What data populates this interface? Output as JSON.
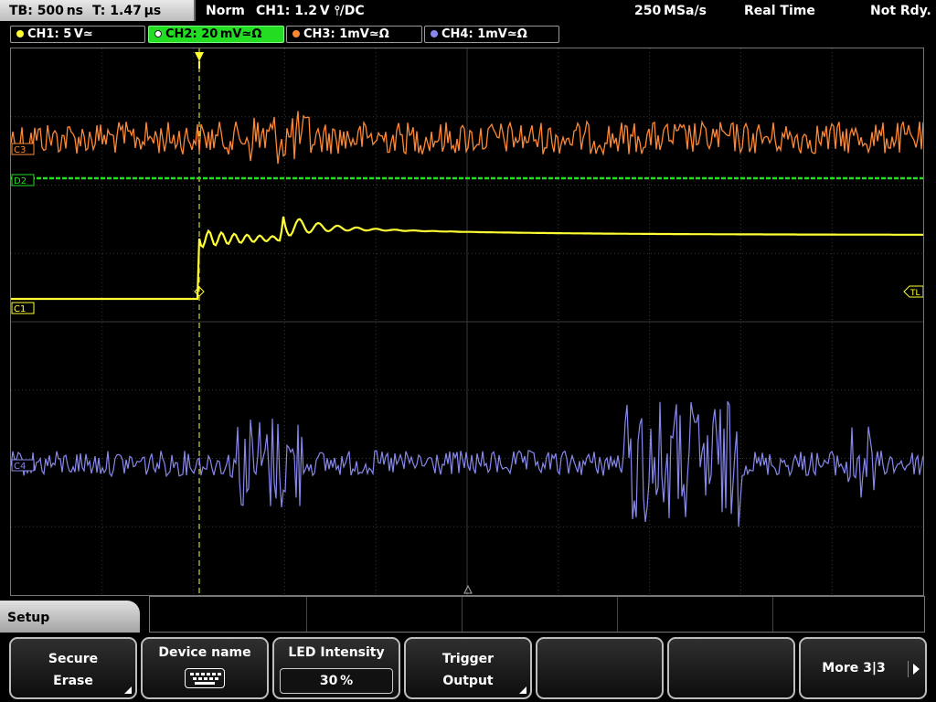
{
  "status_bar": {
    "tb": "TB: 500 ns",
    "t": "T: 1.47 µs",
    "mode": "Norm",
    "trigger": "CH1: 1.2 V ⫯/DC",
    "sample_rate": "250 MSa/s",
    "acq_mode": "Real Time",
    "status": "Not Rdy."
  },
  "channels": [
    {
      "label": "CH1: 5 V≃",
      "color": "#ffff33",
      "active": false
    },
    {
      "label": "CH2: 20 mV≃Ω",
      "color": "#22dd22",
      "active": true
    },
    {
      "label": "CH3: 1mV≃Ω",
      "color": "#ff8833",
      "active": false
    },
    {
      "label": "CH4: 1mV≃Ω",
      "color": "#8888ee",
      "active": false
    }
  ],
  "markers": {
    "ch3": "C3",
    "ch2": "D2",
    "ch1": "C1",
    "ch4": "C4",
    "trigger_level": "TL"
  },
  "setup_tab": {
    "label": "Setup"
  },
  "softkeys": {
    "secure_erase": {
      "line1": "Secure",
      "line2": "Erase"
    },
    "device_name": {
      "line1": "Device name",
      "icon": "keyboard-icon"
    },
    "led_intensity": {
      "line1": "LED Intensity",
      "value": "30 %"
    },
    "trigger_output": {
      "line1": "Trigger",
      "line2": "Output"
    },
    "more": {
      "label": "More 3|3"
    }
  },
  "trace_colors": {
    "ch1": "#ffff33",
    "ch2": "#22dd22",
    "ch3": "#ff8833",
    "ch4": "#8888ee",
    "grid": "#3a3a3a"
  }
}
